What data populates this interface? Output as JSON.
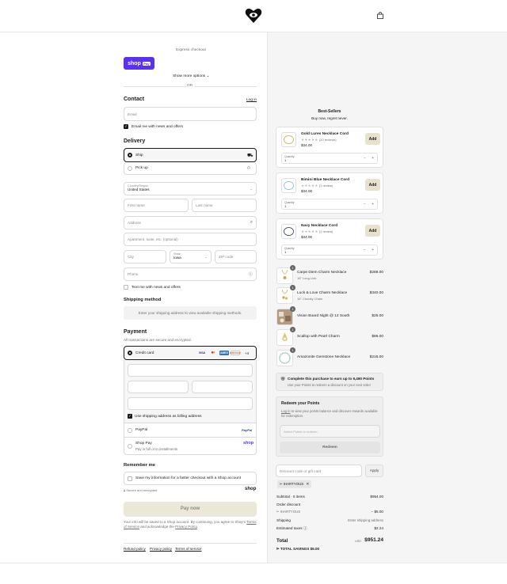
{
  "header": {
    "logo_icon": "heart-eye-logo-icon",
    "cart_icon": "shopping-bag-icon"
  },
  "express": {
    "title": "Express checkout",
    "shop_pay_label": "shop",
    "shop_pay_badge": "Pay",
    "more_options": "Show more options",
    "or": "OR"
  },
  "contact": {
    "title": "Contact",
    "login_link": "Log in",
    "email_placeholder": "Email",
    "email_news_label": "Email me with news and offers",
    "email_news_checked": true
  },
  "delivery": {
    "title": "Delivery",
    "options": [
      {
        "label": "Ship",
        "selected": true,
        "icon": "truck-icon"
      },
      {
        "label": "Pick up",
        "selected": false,
        "icon": "store-icon"
      }
    ],
    "country_label": "Country/Region",
    "country_value": "United States",
    "first_name": "First name",
    "last_name": "Last name",
    "address": "Address",
    "apartment": "Apartment, suite, etc. (optional)",
    "city": "City",
    "state_label": "State",
    "state_value": "Iowa",
    "zip": "ZIP code",
    "phone": "Phone",
    "sms_label": "Text me with news and offers",
    "sms_checked": false
  },
  "shipping_method": {
    "title": "Shipping method",
    "message": "Enter your shipping address to view available shipping methods."
  },
  "payment": {
    "title": "Payment",
    "subtitle": "All transactions are secure and encrypted.",
    "credit_card_label": "Credit card",
    "card_brands": [
      "VISA",
      "MC",
      "AMEX",
      "DISCOVER"
    ],
    "more_brands": "+4",
    "billing_label": "Use shipping address as billing address",
    "billing_checked": true,
    "paypal_label": "PayPal",
    "paypal_logo": "PayPal",
    "shop_pay_label": "Shop Pay",
    "shop_pay_sub": "Pay in full or in installments",
    "shop_logo": "shop"
  },
  "remember": {
    "title": "Remember me",
    "save_label": "Save my information for a faster checkout with a Shop account",
    "secure_label": "Secure and encrypted",
    "shop_logo": "shop"
  },
  "pay_now": "Pay now",
  "legal": {
    "line1": "Your info will be saved to a Shop account. By continuing, you agree to Shop's",
    "terms": "Terms of Service",
    "and": "and acknowledge the",
    "privacy": "Privacy Policy",
    "end": "."
  },
  "footer_links": [
    "Refund policy",
    "Privacy policy",
    "Terms of service"
  ],
  "bestsellers": {
    "title": "Best-Sellers",
    "subtitle": "Buy now, regret never.",
    "products": [
      {
        "name": "Gold Lures Necklace Cord",
        "stars": "★★★★★",
        "reviews": "(20 reviews)",
        "price": "$34.00",
        "add": "Add",
        "qty_label": "Quantity",
        "qty": "1"
      },
      {
        "name": "Bimini Blue Necklace Cord",
        "stars": "★★★★★",
        "reviews": "(1 review)",
        "price": "$34.00",
        "add": "Add",
        "qty_label": "Quantity",
        "qty": "1"
      },
      {
        "name": "Navy Necklace Cord",
        "stars": "★★★★★",
        "reviews": "(1 review)",
        "price": "$34.00",
        "add": "Add",
        "qty_label": "Quantity",
        "qty": "1"
      }
    ]
  },
  "cart_items": [
    {
      "name": "Carpe Diem Charm Necklace",
      "variant": "16\" Long Link",
      "price": "$288.00",
      "qty": "1"
    },
    {
      "name": "Luck & Love Charm Necklace",
      "variant": "16\" Chunky Chain",
      "price": "$340.00",
      "qty": "1"
    },
    {
      "name": "Vision Board Night @ 12 South",
      "variant": "",
      "price": "$25.00",
      "qty": "1"
    },
    {
      "name": "Scallop with Pearl Charm",
      "variant": "",
      "price": "$86.00",
      "qty": "1"
    },
    {
      "name": "Amazonite Gemstone Necklace",
      "variant": "",
      "price": "$215.00",
      "qty": "1"
    }
  ],
  "points_banner": {
    "title": "Complete this purchase to earn up to 9,490 Points",
    "sub": "Use your Points to redeem a discount on your next order"
  },
  "redeem": {
    "title": "Redeem your Points",
    "login": "Log in",
    "text": "to view your points balance and discover rewards available for redemption.",
    "select_placeholder": "Select Points to redeem",
    "button": "Redeem"
  },
  "discount": {
    "placeholder": "Discount code or gift card",
    "apply": "Apply",
    "code": "IHARTYOUS"
  },
  "totals": {
    "subtotal_label": "Subtotal · 5 items",
    "subtotal": "$954.00",
    "order_discount_label": "Order discount",
    "code": "IHARTYOUS",
    "discount": "− $5.00",
    "shipping_label": "Shipping",
    "shipping": "Enter shipping address",
    "taxes_label": "Estimated taxes",
    "taxes": "$2.24",
    "total_label": "Total",
    "currency": "USD",
    "total": "$951.24",
    "savings_label": "TOTAL SAVINGS",
    "savings": "$5.00"
  }
}
